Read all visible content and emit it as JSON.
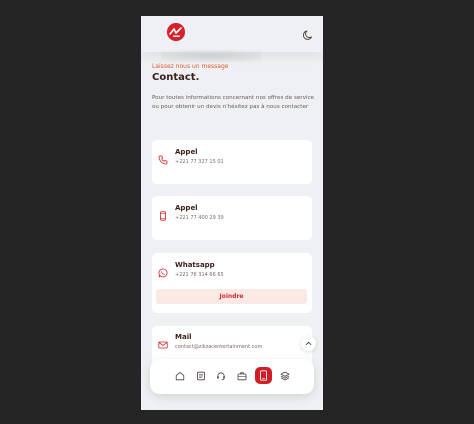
{
  "colors": {
    "accent": "#d21f26",
    "eyebrow": "#e2592c",
    "heading": "#3a1f1f",
    "background": "#eef0f3",
    "card": "#ffffff"
  },
  "header": {
    "logo_icon": "brand-logo",
    "theme_toggle_icon": "moon-icon"
  },
  "intro": {
    "eyebrow": "Laissez nous un message",
    "title": "Contact.",
    "description": "Pour toutes informations concernant nos offres de service ou pour obtenir un devis n'hésitez pas à nous contacter"
  },
  "contacts": [
    {
      "icon": "phone-icon",
      "label": "Appel",
      "value": "+221 77 327 15 01"
    },
    {
      "icon": "mobile-phone-icon",
      "label": "Appel",
      "value": "+221 77 400 29 39"
    },
    {
      "icon": "whatsapp-icon",
      "label": "Whatsapp",
      "value": "+221 76 314 66 65",
      "action": "Joindre"
    },
    {
      "icon": "mail-icon",
      "label": "Mail",
      "value": "contact@zikzacentertainment.com"
    }
  ],
  "scroll_top_icon": "chevron-up-icon",
  "bottom_nav": [
    {
      "icon": "home-icon"
    },
    {
      "icon": "document-icon"
    },
    {
      "icon": "headset-icon"
    },
    {
      "icon": "briefcase-icon"
    },
    {
      "icon": "mobile-phone-icon",
      "active": true
    },
    {
      "icon": "layers-icon"
    }
  ]
}
